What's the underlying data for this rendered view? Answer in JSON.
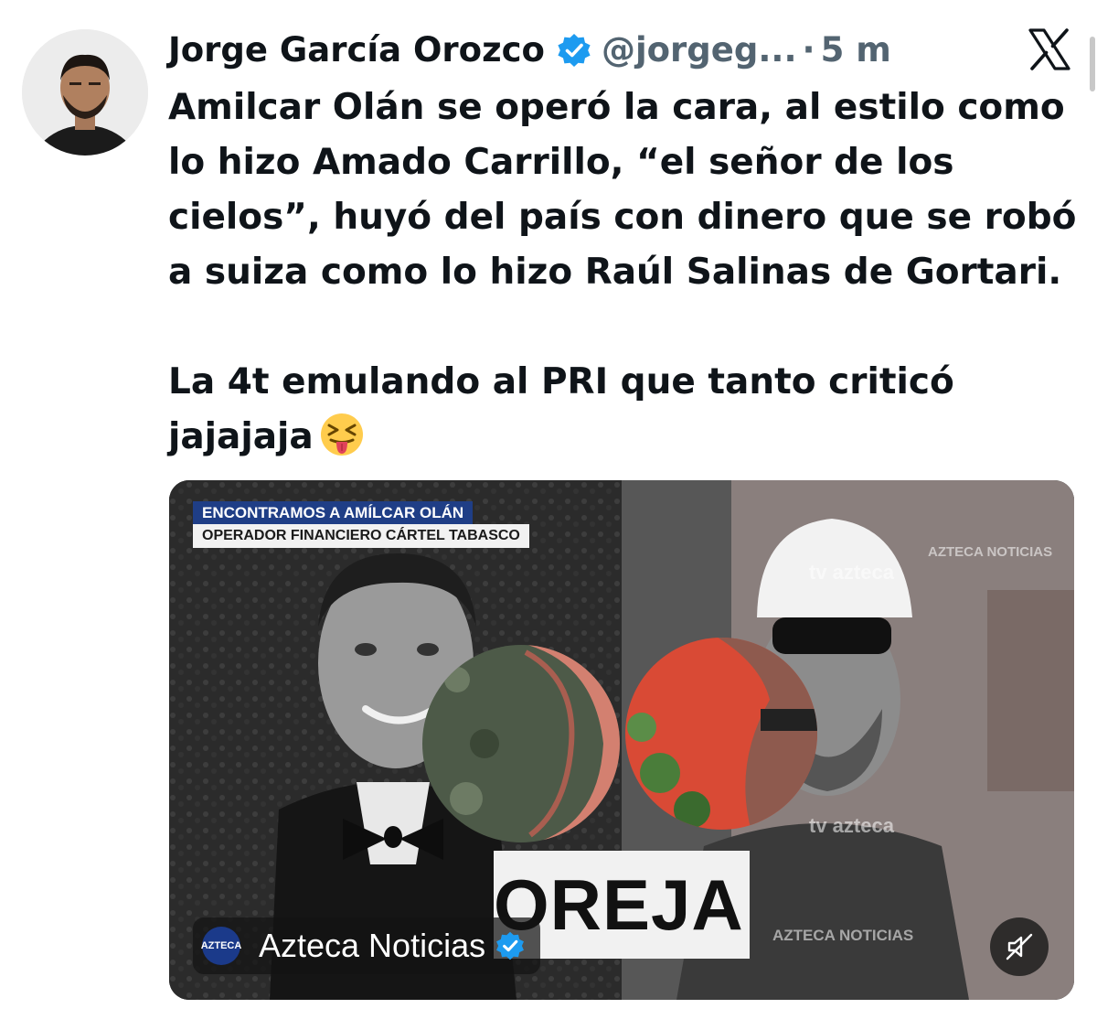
{
  "tweet": {
    "author_name": "Jorge García Orozco",
    "handle": "@jorgeg...",
    "separator": "·",
    "time": "5 m",
    "text_paragraph_1": "Amilcar Olán se operó la cara, al estilo como lo hizo Amado Carrillo, “el señor de los cielos”, huyó del país con dinero que se robó a suiza como lo hizo Raúl Salinas de Gortari.",
    "text_paragraph_2": "La 4t emulando al PRI que tanto criticó jajajaja",
    "emoji_icon": "squinting-face-with-tongue-icon"
  },
  "media": {
    "chyron_headline": "ENCONTRAMOS A AMÍLCAR OLÁN",
    "chyron_subtitle": "OPERADOR FINANCIERO CÁRTEL TABASCO",
    "caption": "OREJA",
    "watermark_brand": "AZTECA NOTICIAS",
    "watermark_tv": "tv azteca",
    "channel_logo_text": "AZTECA",
    "channel_name": "Azteca Noticias",
    "mute_icon": "muted-speaker-icon"
  },
  "icons": {
    "x_logo": "x-logo-icon",
    "verified": "verified-badge-icon"
  },
  "colors": {
    "verified_blue": "#1d9bf0",
    "secondary_text": "#536471",
    "primary_text": "#0f1419",
    "chyron_blue": "#1f3e86"
  }
}
